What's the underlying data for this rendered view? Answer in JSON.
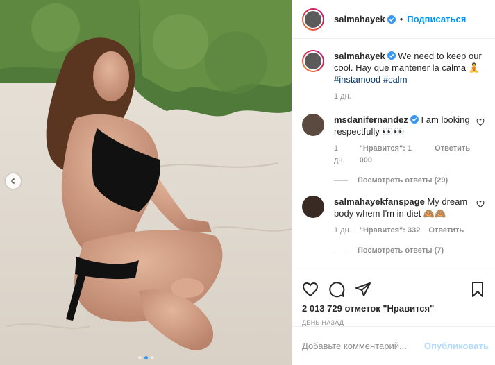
{
  "post": {
    "username": "salmahayek",
    "follow_label": "Подписаться",
    "separator": "•"
  },
  "caption": {
    "username": "salmahayek",
    "text": "We need to keep our cool. Hay que mantener la calma 🧘",
    "hashtags": [
      "#instamood",
      "#calm"
    ],
    "age": "1 дн."
  },
  "comments": [
    {
      "username": "msdanifernandez",
      "verified": true,
      "text": "I am looking respectfully 👀👀",
      "age": "1 дн.",
      "likes": "\"Нравится\": 1 000",
      "reply_label": "Ответить",
      "view_replies": "Посмотреть ответы (29)"
    },
    {
      "username": "salmahayekfanspage",
      "verified": false,
      "text": "My dream body whem I'm in diet 🙈🙈",
      "age": "1 дн.",
      "likes": "\"Нравится\": 332",
      "reply_label": "Ответить",
      "view_replies": "Посмотреть ответы (7)"
    }
  ],
  "stats": {
    "likes": "2 013 729 отметок \"Нравится\"",
    "posted": "ДЕНЬ НАЗАД"
  },
  "comment_box": {
    "placeholder": "Добавьте комментарий...",
    "post_label": "Опубликовать"
  },
  "icons": {
    "like": "heart-icon",
    "comment": "comment-icon",
    "share": "paper-plane-icon",
    "save": "bookmark-icon",
    "verified": "verified-badge-icon",
    "prev": "chevron-left-icon"
  },
  "colors": {
    "accent": "#0095f6",
    "verified": "#3897f0",
    "hashtag": "#00376b",
    "muted": "#8e8e8e",
    "post_disabled": "#b3dbff"
  },
  "carousel": {
    "slides": 3,
    "active_index": 1
  }
}
